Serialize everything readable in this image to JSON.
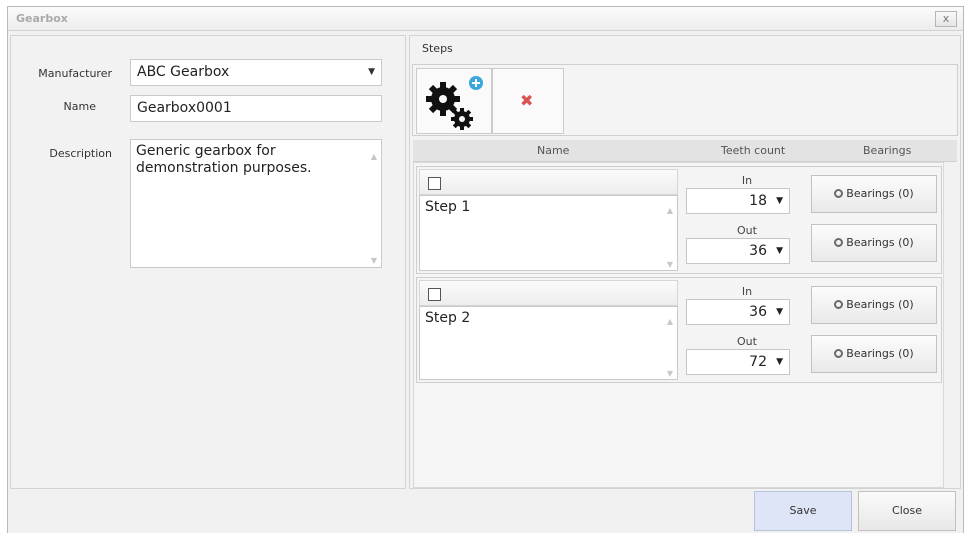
{
  "window": {
    "title": "Gearbox",
    "close_glyph": "x"
  },
  "form": {
    "manufacturer_label": "Manufacturer",
    "manufacturer_value": "ABC Gearbox",
    "name_label": "Name",
    "name_value": "Gearbox0001",
    "description_label": "Description",
    "description_value": "Generic gearbox for demonstration purposes."
  },
  "steps": {
    "section_label": "Steps",
    "toolbar": {
      "add_icon": "add-gears-icon",
      "remove_icon": "red-x-icon",
      "remove_glyph": "✖"
    },
    "columns": {
      "name": "Name",
      "teeth": "Teeth count",
      "bearings": "Bearings"
    },
    "items": [
      {
        "name": "Step 1",
        "in_label": "In",
        "in_value": "18",
        "out_label": "Out",
        "out_value": "36",
        "in_bearings": "Bearings (0)",
        "out_bearings": "Bearings (0)"
      },
      {
        "name": "Step 2",
        "in_label": "In",
        "in_value": "36",
        "out_label": "Out",
        "out_value": "72",
        "in_bearings": "Bearings (0)",
        "out_bearings": "Bearings (0)"
      }
    ]
  },
  "footer": {
    "save_label": "Save",
    "close_label": "Close"
  },
  "colors": {
    "save_button_bg": "#dde5f7",
    "remove_icon": "#d9534f",
    "add_badge": "#3aa8df"
  }
}
